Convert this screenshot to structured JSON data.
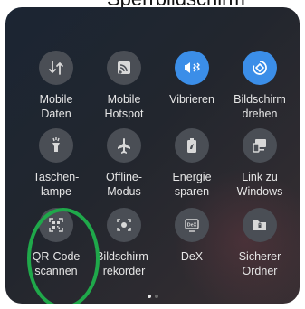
{
  "top_text": "Sperrbildschirm",
  "tiles": [
    {
      "icon": "data-transfer-icon",
      "active": false,
      "line1": "Mobile",
      "line2": "Daten"
    },
    {
      "icon": "hotspot-icon",
      "active": false,
      "line1": "Mobile",
      "line2": "Hotspot"
    },
    {
      "icon": "vibrate-icon",
      "active": true,
      "line1": "Vibrieren",
      "line2": ""
    },
    {
      "icon": "rotate-screen-icon",
      "active": true,
      "line1": "Bildschirm",
      "line2": "drehen"
    },
    {
      "icon": "flashlight-icon",
      "active": false,
      "line1": "Taschen-",
      "line2": "lampe"
    },
    {
      "icon": "airplane-icon",
      "active": false,
      "line1": "Offline-",
      "line2": "Modus"
    },
    {
      "icon": "battery-saver-icon",
      "active": false,
      "line1": "Energie",
      "line2": "sparen"
    },
    {
      "icon": "link-to-windows-icon",
      "active": false,
      "line1": "Link zu",
      "line2": "Windows"
    },
    {
      "icon": "qr-code-scanner-icon",
      "active": false,
      "line1": "QR-Code",
      "line2": "scannen"
    },
    {
      "icon": "screen-recorder-icon",
      "active": false,
      "line1": "Bildschirm-",
      "line2": "rekorder"
    },
    {
      "icon": "dex-icon",
      "active": false,
      "line1": "DeX",
      "line2": ""
    },
    {
      "icon": "secure-folder-icon",
      "active": false,
      "line1": "Sicherer",
      "line2": "Ordner"
    }
  ],
  "colors": {
    "active": "#3b8ee8",
    "inactive": "#4a4e55",
    "highlight": "#1fa84a"
  },
  "pager": {
    "pages": 2,
    "current": 1
  }
}
